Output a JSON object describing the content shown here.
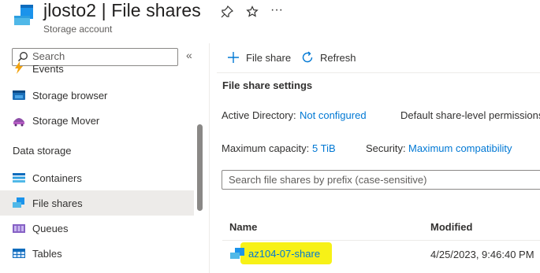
{
  "header": {
    "title": "jlosto2 | File shares",
    "subtitle": "Storage account",
    "pin_icon": "pin-icon",
    "star_icon": "star-icon",
    "more_label": "···"
  },
  "sidebar": {
    "search_placeholder": "Search",
    "collapse_label": "«",
    "items_top": [
      {
        "label": "Events",
        "icon": "events-icon"
      },
      {
        "label": "Storage browser",
        "icon": "storage-browser-icon"
      },
      {
        "label": "Storage Mover",
        "icon": "storage-mover-icon"
      }
    ],
    "section_header": "Data storage",
    "items_data": [
      {
        "label": "Containers",
        "icon": "containers-icon"
      },
      {
        "label": "File shares",
        "icon": "file-shares-icon",
        "active": true
      },
      {
        "label": "Queues",
        "icon": "queues-icon"
      },
      {
        "label": "Tables",
        "icon": "tables-icon"
      }
    ]
  },
  "toolbar": {
    "add_label": "File share",
    "refresh_label": "Refresh"
  },
  "settings": {
    "title": "File share settings",
    "active_directory_label": "Active Directory:",
    "active_directory_value": "Not configured",
    "default_perm_label": "Default share-level permissions",
    "max_capacity_label": "Maximum capacity:",
    "max_capacity_value": "5 TiB",
    "security_label": "Security:",
    "security_value": "Maximum compatibility"
  },
  "filter": {
    "placeholder": "Search file shares by prefix (case-sensitive)"
  },
  "table": {
    "columns": [
      "Name",
      "Modified"
    ],
    "rows": [
      {
        "name": "az104-07-share",
        "modified": "4/25/2023, 9:46:40 PM"
      }
    ]
  },
  "colors": {
    "accent": "#0078d4",
    "highlight": "#f7f117"
  }
}
